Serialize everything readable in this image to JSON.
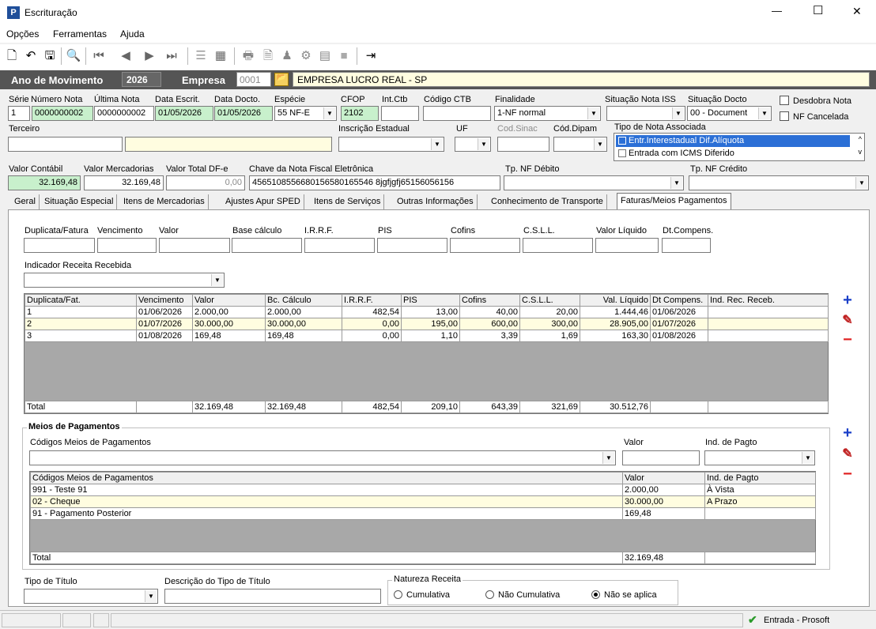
{
  "window": {
    "title": "Escrituração",
    "app_icon": "P",
    "min": "—",
    "max": "☐",
    "close": "✕"
  },
  "menu": [
    "Opções",
    "Ferramentas",
    "Ajuda"
  ],
  "header": {
    "ano_label": "Ano de Movimento",
    "ano": "2026",
    "empresa_label": "Empresa",
    "empresa_code": "0001",
    "empresa_name": "EMPRESA LUCRO REAL - SP"
  },
  "nota": {
    "serie_label": "Série",
    "serie": "1",
    "numero_label": "Número Nota",
    "numero": "0000000002",
    "ultima_label": "Última Nota",
    "ultima": "0000000002",
    "data_escrit_label": "Data Escrit.",
    "data_escrit": "01/05/2026",
    "data_docto_label": "Data Docto.",
    "data_docto": "01/05/2026",
    "especie_label": "Espécie",
    "especie": "55   NF-E",
    "cfop_label": "CFOP",
    "cfop": "2102",
    "intctb_label": "Int.Ctb",
    "codctb_label": "Código CTB",
    "finalidade_label": "Finalidade",
    "finalidade": "1-NF normal",
    "sit_iss_label": "Situação Nota ISS",
    "sit_docto_label": "Situação Docto",
    "sit_docto": "00 - Document",
    "desdobra_label": "Desdobra Nota",
    "cancelada_label": "NF Cancelada",
    "terceiro_label": "Terceiro",
    "ie_label": "Inscrição Estadual",
    "uf_label": "UF",
    "sinac_label": "Cod.Sinac",
    "dipam_label": "Cód.Dipam",
    "tipo_assoc_label": "Tipo de Nota Associada",
    "tipo_assoc_options": [
      "Entr.Interestadual Dif.Alíquota",
      "Entrada com ICMS Diferido"
    ],
    "valor_contabil_label": "Valor Contábil",
    "valor_contabil": "32.169,48",
    "valor_merc_label": "Valor Mercadorias",
    "valor_merc": "32.169,48",
    "valor_dfe_label": "Valor Total DF-e",
    "valor_dfe": "0,00",
    "chave_label": "Chave da Nota Fiscal Eletrônica",
    "chave": "4565108556680156580165546 8jgfjgfj65156056156",
    "tp_debito_label": "Tp. NF Débito",
    "tp_credito_label": "Tp. NF Crédito"
  },
  "tabs": [
    "Geral",
    "Situação Especial",
    "Itens de Mercadorias",
    "Ajustes Apur SPED",
    "Itens de Serviços",
    "Outras Informações",
    "Conhecimento de Transporte",
    "Faturas/Meios Pagamentos"
  ],
  "faturas_form": {
    "labels": [
      "Duplicata/Fatura",
      "Vencimento",
      "Valor",
      "Base cálculo",
      "I.R.R.F.",
      "PIS",
      "Cofins",
      "C.S.L.L.",
      "Valor Líquido",
      "Dt.Compens."
    ],
    "indicador_label": "Indicador Receita Recebida"
  },
  "faturas_table": {
    "headers": [
      "Duplicata/Fat.",
      "Vencimento",
      "Valor",
      "Bc. Cálculo",
      "I.R.R.F.",
      "PIS",
      "Cofins",
      "C.S.L.L.",
      "Val. Líquido",
      "Dt Compens.",
      "Ind. Rec. Receb."
    ],
    "rows": [
      [
        "1",
        "01/06/2026",
        "2.000,00",
        "2.000,00",
        "482,54",
        "13,00",
        "40,00",
        "20,00",
        "1.444,46",
        "01/06/2026",
        ""
      ],
      [
        "2",
        "01/07/2026",
        "30.000,00",
        "30.000,00",
        "0,00",
        "195,00",
        "600,00",
        "300,00",
        "28.905,00",
        "01/07/2026",
        ""
      ],
      [
        "3",
        "01/08/2026",
        "169,48",
        "169,48",
        "0,00",
        "1,10",
        "3,39",
        "1,69",
        "163,30",
        "01/08/2026",
        ""
      ]
    ],
    "total": [
      "Total",
      "",
      "32.169,48",
      "32.169,48",
      "482,54",
      "209,10",
      "643,39",
      "321,69",
      "30.512,76",
      "",
      ""
    ]
  },
  "meios": {
    "title": "Meios de Pagamentos",
    "codigos_label": "Códigos Meios de Pagamentos",
    "valor_label": "Valor",
    "ind_label": "Ind. de Pagto",
    "headers": [
      "Códigos Meios de Pagamentos",
      "Valor",
      "Ind. de Pagto"
    ],
    "rows": [
      [
        "991 - Teste 91",
        "2.000,00",
        "À Vista"
      ],
      [
        "02 - Cheque",
        "30.000,00",
        "A Prazo"
      ],
      [
        "91 - Pagamento Posterior",
        "169,48",
        ""
      ]
    ],
    "total": [
      "Total",
      "32.169,48",
      ""
    ]
  },
  "bottom": {
    "tipo_titulo_label": "Tipo de Título",
    "desc_titulo_label": "Descrição do Tipo de Título",
    "natureza_label": "Natureza Receita",
    "radios": [
      "Cumulativa",
      "Não Cumulativa",
      "Não se aplica"
    ],
    "selected": "Não se aplica"
  },
  "status": {
    "text": "Entrada - Prosoft"
  },
  "colors": {
    "header_bar": "#555555",
    "selected_row": "#fffde0",
    "list_selected": "#2b6fd6",
    "plus": "#1a3fc8",
    "minus": "#e02020"
  }
}
